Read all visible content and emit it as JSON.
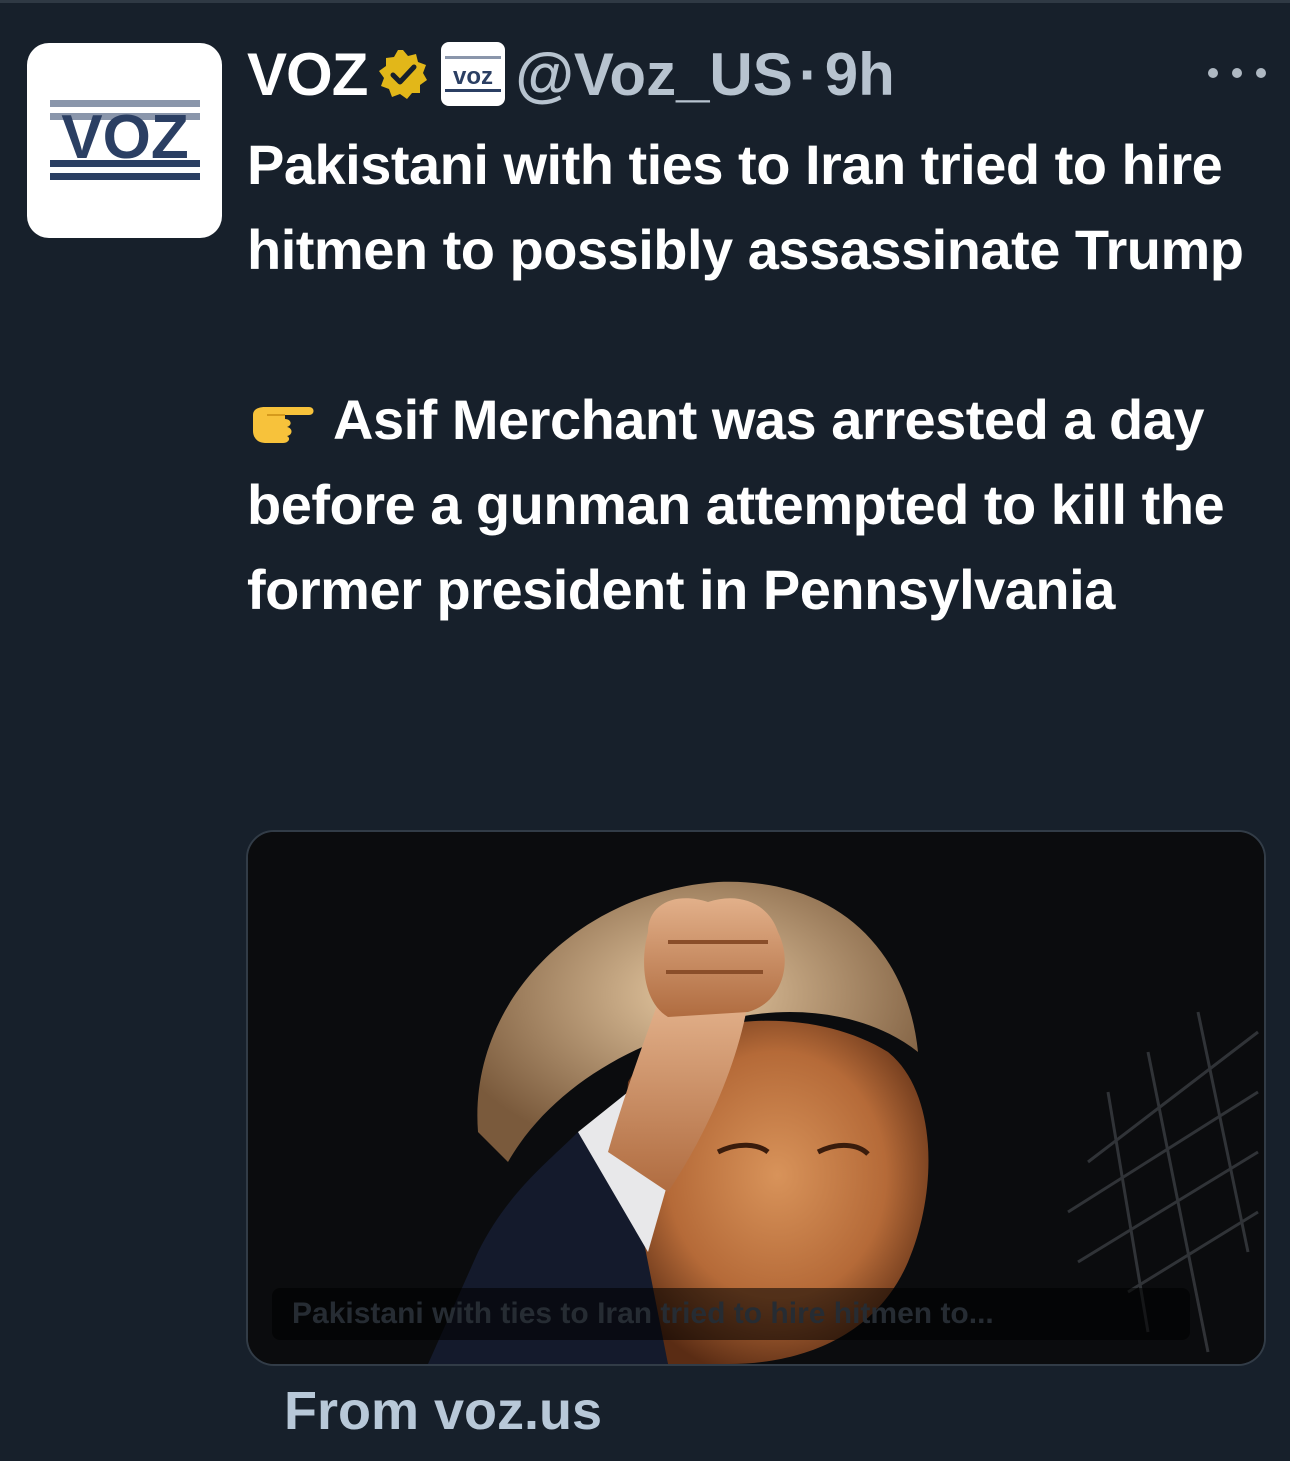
{
  "tweet": {
    "author": {
      "display_name": "VOZ",
      "handle": "@Voz_US",
      "separator": "·",
      "time": "9h",
      "avatar_text": "VOZ",
      "affiliate_badge_text": "voz",
      "verified_badge": "gold-verified-badge-icon"
    },
    "more_icon": "more-options-icon",
    "text": {
      "headline": "Pakistani with ties to Iran tried to hire hitmen to possibly assassinate Trump",
      "bullet_emoji": "pointing-right-hand-icon",
      "body": "Asif Merchant was arrested a day before a gunman attempted to kill the former president in Pennsylvania"
    },
    "card": {
      "caption": "Pakistani with ties to Iran tried to hire hitmen to...",
      "source": "From voz.us"
    }
  },
  "colors": {
    "background": "#17202b",
    "text_primary": "#ffffff",
    "text_secondary": "#b7c3cf",
    "verified_gold": "#e2b719",
    "brand_navy": "#2b3f63"
  }
}
